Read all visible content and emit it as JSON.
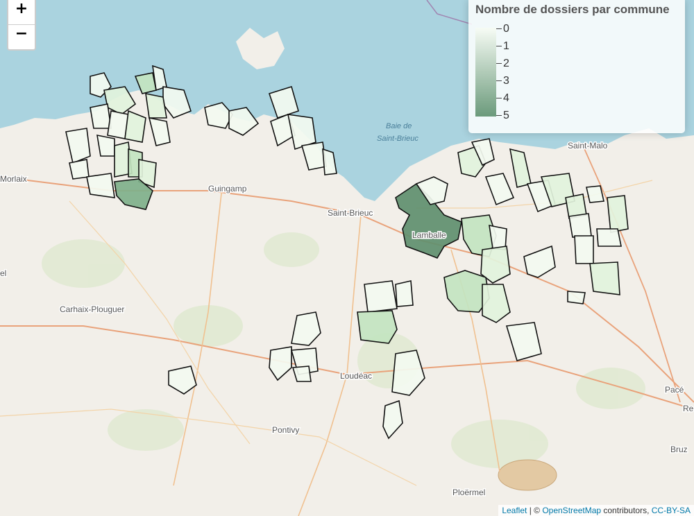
{
  "map": {
    "zoom_in": "+",
    "zoom_out": "−",
    "towns": {
      "morlaix": "Morlaix",
      "guingamp": "Guingamp",
      "saint_brieuc": "Saint-Brieuc",
      "lamballe": "Lamballe",
      "saint_malo": "Saint-Malo",
      "carhaix": "Carhaix-Plouguer",
      "loudeac": "Loudéac",
      "pontivy": "Pontivy",
      "ploermel": "Ploërmel",
      "pace": "Pacé",
      "bruz": "Bruz",
      "rennes_fragment": "Re",
      "el_fragment": "el"
    },
    "bay_line1": "Baie de",
    "bay_line2": "Saint-Brieuc"
  },
  "legend": {
    "title": "Nombre de dossiers par commune",
    "labels": [
      "0",
      "1",
      "2",
      "3",
      "4",
      "5"
    ],
    "color_low": "#f7fcf5",
    "color_high": "#6b9a7b"
  },
  "attribution": {
    "leaflet": "Leaflet",
    "sep": " | © ",
    "osm": "OpenStreetMap",
    "contributors": " contributors, ",
    "license": "CC-BY-SA"
  },
  "colors": {
    "sea": "#aad3df",
    "land": "#f2efe9",
    "c0": "#f3faf0",
    "c1": "#e2f3dc",
    "c2": "#c3e4c0",
    "c3": "#a6d0a6",
    "c4": "#7fb08a",
    "c5": "#5f8f6e"
  }
}
